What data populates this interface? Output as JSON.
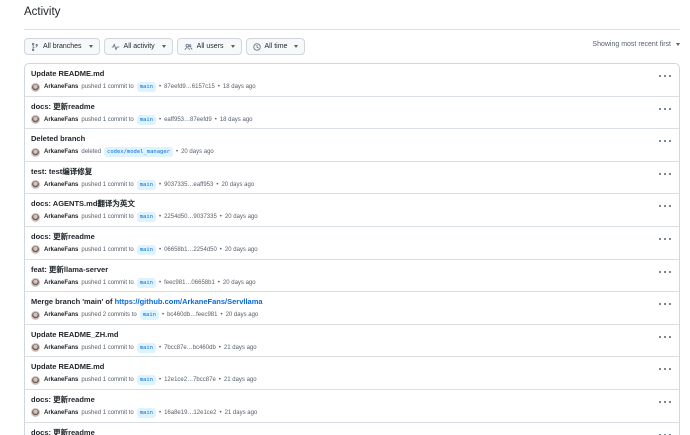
{
  "title": "Activity",
  "filters": {
    "branches": "All branches",
    "activity": "All activity",
    "users": "All users",
    "time": "All time"
  },
  "sort_label": "Showing most recent first",
  "rows": [
    {
      "title": "Update README.md",
      "link": "",
      "user": "ArkaneFans",
      "action": "pushed 1 commit to",
      "branch": "main",
      "range": "87eefd9…6157c15",
      "time": "18 days ago"
    },
    {
      "title": "docs: 更新readme",
      "link": "",
      "user": "ArkaneFans",
      "action": "pushed 1 commit to",
      "branch": "main",
      "range": "eaff953…87eefd9",
      "time": "18 days ago"
    },
    {
      "title": "Deleted branch",
      "link": "",
      "user": "ArkaneFans",
      "action": "deleted",
      "branch": "codex/model_manager",
      "range": "",
      "time": "20 days ago"
    },
    {
      "title": "test: test编译修复",
      "link": "",
      "user": "ArkaneFans",
      "action": "pushed 1 commit to",
      "branch": "main",
      "range": "9037335…eaff953",
      "time": "20 days ago"
    },
    {
      "title": "docs: AGENTS.md翻译为英文",
      "link": "",
      "user": "ArkaneFans",
      "action": "pushed 1 commit to",
      "branch": "main",
      "range": "2254d50…9037335",
      "time": "20 days ago"
    },
    {
      "title": "docs: 更新readme",
      "link": "",
      "user": "ArkaneFans",
      "action": "pushed 1 commit to",
      "branch": "main",
      "range": "06658b1…2254d50",
      "time": "20 days ago"
    },
    {
      "title": "feat: 更新llama-server",
      "link": "",
      "user": "ArkaneFans",
      "action": "pushed 1 commit to",
      "branch": "main",
      "range": "feec981…06658b1",
      "time": "20 days ago"
    },
    {
      "title": "Merge branch 'main' of",
      "link": "https://github.com/ArkaneFans/Servllama",
      "user": "ArkaneFans",
      "action": "pushed 2 commits to",
      "branch": "main",
      "range": "bc460db…feec981",
      "time": "20 days ago"
    },
    {
      "title": "Update README_ZH.md",
      "link": "",
      "user": "ArkaneFans",
      "action": "pushed 1 commit to",
      "branch": "main",
      "range": "7bcc87e…bc460db",
      "time": "21 days ago"
    },
    {
      "title": "Update README.md",
      "link": "",
      "user": "ArkaneFans",
      "action": "pushed 1 commit to",
      "branch": "main",
      "range": "12e1ce2…7bcc87e",
      "time": "21 days ago"
    },
    {
      "title": "docs: 更新readme",
      "link": "",
      "user": "ArkaneFans",
      "action": "pushed 1 commit to",
      "branch": "main",
      "range": "16a8e19…12e1ce2",
      "time": "21 days ago"
    },
    {
      "title": "docs: 更新readme",
      "link": "",
      "user": "",
      "action": "",
      "branch": "",
      "range": "",
      "time": ""
    }
  ]
}
